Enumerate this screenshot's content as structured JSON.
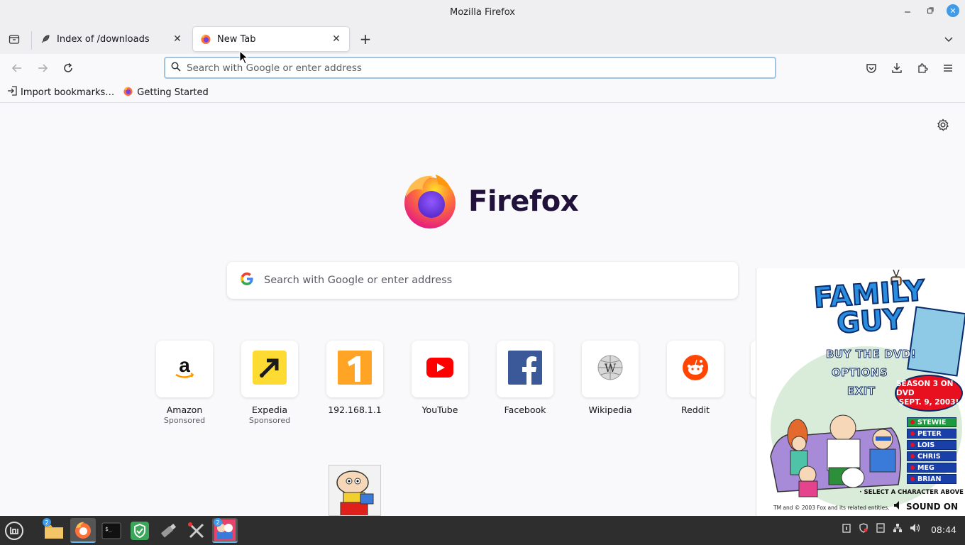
{
  "window": {
    "title": "Mozilla Firefox",
    "minimize_icon": "minimize-icon",
    "maximize_icon": "maximize-icon",
    "close_icon": "close-icon"
  },
  "tabs": [
    {
      "label": "Index of /downloads",
      "icon": "rocket-icon",
      "active": false
    },
    {
      "label": "New Tab",
      "icon": "firefox-icon",
      "active": true
    }
  ],
  "urlbar": {
    "placeholder": "Search with Google or enter address",
    "value": ""
  },
  "bookmarks": [
    {
      "label": "Import bookmarks…",
      "icon": "import-icon"
    },
    {
      "label": "Getting Started",
      "icon": "firefox-icon"
    }
  ],
  "newtab": {
    "brand": "Firefox",
    "search_placeholder": "Search with Google or enter address",
    "top_sites": [
      {
        "title": "Amazon",
        "sub": "Sponsored",
        "icon": "amazon-icon"
      },
      {
        "title": "Expedia",
        "sub": "Sponsored",
        "icon": "expedia-icon"
      },
      {
        "title": "192.168.1.1",
        "sub": "",
        "icon": "number-one-icon"
      },
      {
        "title": "YouTube",
        "sub": "",
        "icon": "youtube-icon"
      },
      {
        "title": "Facebook",
        "sub": "",
        "icon": "facebook-icon"
      },
      {
        "title": "Wikipedia",
        "sub": "",
        "icon": "wikipedia-icon"
      },
      {
        "title": "Reddit",
        "sub": "",
        "icon": "reddit-icon"
      }
    ]
  },
  "ad": {
    "title_line1": "FAMILY",
    "title_line2": "GUY",
    "menu": [
      "BUY THE DVD!",
      "OPTIONS",
      "EXIT"
    ],
    "badge_line1": "SEASON 3 ON DVD",
    "badge_line2": "SEPT. 9, 2003!",
    "characters": [
      "STEWIE",
      "PETER",
      "LOIS",
      "CHRIS",
      "MEG",
      "BRIAN"
    ],
    "select_text": "· SELECT A CHARACTER ABOVE",
    "copyright": "TM and © 2003 Fox and its related entities.",
    "sound": "SOUND ON"
  },
  "taskbar": {
    "items": [
      "menu-icon",
      "files-icon",
      "firefox-icon",
      "terminal-icon",
      "shield-icon",
      "usb-icon",
      "tools-icon",
      "familyguy-icon"
    ],
    "files_badge": "2",
    "familyguy_badge": "2",
    "clock": "08:44"
  }
}
